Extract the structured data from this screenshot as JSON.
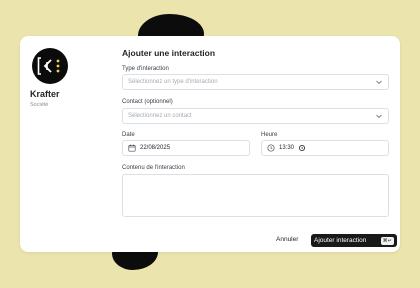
{
  "company": {
    "name": "Krafter",
    "type": "Société",
    "logo_icon": "krafter-logo-icon"
  },
  "modal": {
    "title": "Ajouter une interaction",
    "interaction_type": {
      "label": "Type d'interaction",
      "placeholder": "Sélectionnez un type d'interaction",
      "icon": "chevron-down-icon"
    },
    "contact": {
      "label": "Contact (optionnel)",
      "placeholder": "Sélectionnez un contact",
      "icon": "chevron-down-icon"
    },
    "date": {
      "label": "Date",
      "value": "22/08/2025",
      "icon": "calendar-icon"
    },
    "time": {
      "label": "Heure",
      "value": "13:30",
      "icon": "clock-icon"
    },
    "content": {
      "label": "Contenu de l'interaction",
      "value": ""
    },
    "cancel_label": "Annuler",
    "submit_label": "Ajouter interaction",
    "submit_shortcut": "⌘↵"
  },
  "colors": {
    "background": "#ebe4ad",
    "logo_accent": "#f2d24b",
    "primary_button": "#18191b"
  }
}
